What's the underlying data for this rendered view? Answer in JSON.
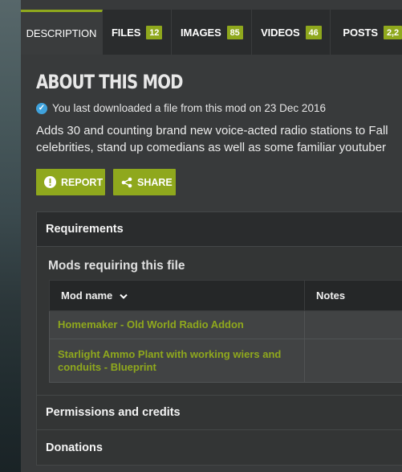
{
  "tabs": [
    {
      "label": "DESCRIPTION",
      "count": ""
    },
    {
      "label": "FILES",
      "count": "12"
    },
    {
      "label": "IMAGES",
      "count": "85"
    },
    {
      "label": "VIDEOS",
      "count": "46"
    },
    {
      "label": "POSTS",
      "count": "2,2"
    }
  ],
  "about": {
    "title": "ABOUT THIS MOD",
    "download_note": "You last downloaded a file from this mod on 23 Dec 2016",
    "description_lines": [
      "Adds 30 and counting brand new voice-acted radio stations to Fall",
      "celebrities, stand up comedians as well as some familiar youtuber"
    ]
  },
  "actions": {
    "report": "REPORT",
    "share": "SHARE"
  },
  "requirements": {
    "header": "Requirements",
    "subtitle": "Mods requiring this file",
    "columns": {
      "mod_name": "Mod name",
      "notes": "Notes"
    },
    "rows": [
      {
        "name": "Homemaker - Old World Radio Addon",
        "notes": ""
      },
      {
        "name_lines": [
          "Starlight Ammo Plant with working wiers and",
          "conduits - Blueprint"
        ],
        "notes": ""
      }
    ]
  },
  "sections": {
    "permissions": "Permissions and credits",
    "donations": "Donations"
  },
  "colors": {
    "accent": "#8fa81d",
    "check": "#3fa2dc"
  }
}
